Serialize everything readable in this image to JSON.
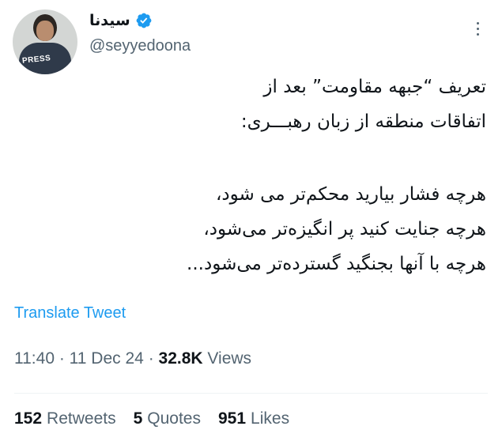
{
  "author": {
    "display_name": "سیدنا",
    "handle": "@seyyedoona",
    "verified": true,
    "avatar_badge_text": "PRESS"
  },
  "tweet": {
    "lines": [
      "تعریف “جبهه مقاومت” بعد از",
      "اتفاقات منطقه از زبان رهبـــری:",
      "هرچه فشار بیارید محکم‌تر می شود،",
      "هرچه جنایت کنید پر انگیزه‌تر می‌شود،",
      "هرچه با آنها بجنگید گسترده‌تر می‌شود..."
    ]
  },
  "translate_label": "Translate Tweet",
  "meta": {
    "time": "11:40",
    "date": "11 Dec 24",
    "views_count": "32.8K",
    "views_label": "Views"
  },
  "stats": {
    "retweets_count": "152",
    "retweets_label": "Retweets",
    "quotes_count": "5",
    "quotes_label": "Quotes",
    "likes_count": "951",
    "likes_label": "Likes"
  },
  "colors": {
    "accent": "#1d9bf0",
    "secondary_text": "#536471",
    "primary_text": "#0f1419"
  },
  "icons": [
    "verified-badge-icon",
    "more-options-icon"
  ]
}
